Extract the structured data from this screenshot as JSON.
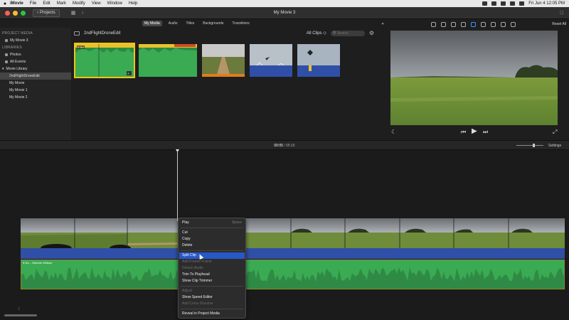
{
  "menubar": {
    "apple": "",
    "items": [
      "iMovie",
      "File",
      "Edit",
      "Mark",
      "Modify",
      "View",
      "Window",
      "Help"
    ],
    "clock": "Fri Jun 4  12:05 PM"
  },
  "titlebar": {
    "projects_label": "Projects",
    "window_title": "My Movie 3"
  },
  "media_tabs": [
    "My Media",
    "Audio",
    "Titles",
    "Backgrounds",
    "Transitions"
  ],
  "sidebar": {
    "project_media_header": "PROJECT MEDIA",
    "project_item": "My Movie 3",
    "libraries_header": "LIBRARIES",
    "photos": "Photos",
    "all_events": "All Events",
    "library_name": "Movie Library",
    "events": [
      "2ndFlightDroneEdit",
      "My Movie",
      "My Movie 1",
      "My Movie 2"
    ]
  },
  "browser": {
    "event_title": "2ndFlightDroneEdit",
    "clips_filter": "All Clips ◇",
    "search_placeholder": "Search",
    "thumb_duration": "5.5m"
  },
  "viewer": {
    "reset_all": "Reset All"
  },
  "timeline": {
    "current_time": "00:05",
    "separator": "/",
    "total_time": "05:16",
    "settings": "Settings",
    "music_label": "5.5m – Michele William"
  },
  "context_menu": {
    "items": [
      {
        "label": "Play",
        "shortcut": "Space",
        "disabled": false
      },
      {
        "sep": true
      },
      {
        "label": "Cut",
        "disabled": false
      },
      {
        "label": "Copy",
        "disabled": false
      },
      {
        "label": "Delete",
        "disabled": false
      },
      {
        "sep": true
      },
      {
        "label": "Split Clip",
        "disabled": false,
        "highlight": true
      },
      {
        "label": "Add Freeze Frame",
        "disabled": true
      },
      {
        "label": "Detach Audio",
        "disabled": true
      },
      {
        "label": "Trim To Playhead",
        "disabled": false
      },
      {
        "label": "Show Clip Trimmer",
        "disabled": false
      },
      {
        "sep": true
      },
      {
        "label": "Adjust",
        "disabled": true
      },
      {
        "label": "Show Speed Editor",
        "disabled": false
      },
      {
        "label": "Add Cross Dissolve",
        "disabled": true
      },
      {
        "sep": true
      },
      {
        "label": "Reveal in Project Media",
        "disabled": false
      }
    ]
  },
  "colors": {
    "accent": "#2758c9",
    "selection": "#f0c419",
    "audio_green": "#3aaa53",
    "audio_blue": "#2f4fa8"
  }
}
